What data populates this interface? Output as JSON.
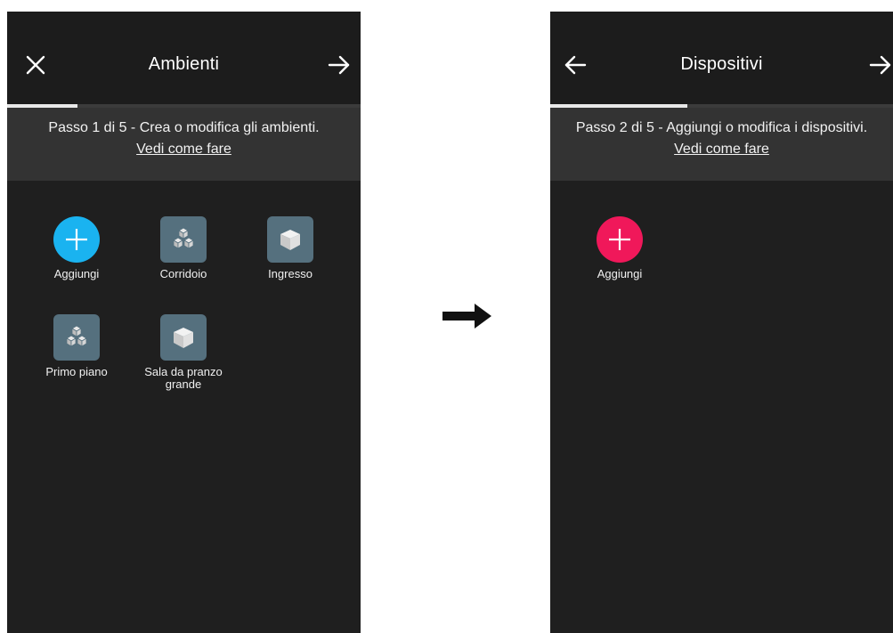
{
  "colors": {
    "add_ambienti": "#1ab3f0",
    "add_dispositivi": "#f0185a",
    "tile_bg": "#55707e"
  },
  "screen1": {
    "title": "Ambienti",
    "progress": 0.2,
    "step_text": "Passo 1 di 5 - Crea o modifica gli ambienti.",
    "help_link": "Vedi come fare",
    "tiles": [
      {
        "label": "Aggiungi",
        "icon": "plus-icon"
      },
      {
        "label": "Corridoio",
        "icon": "cubes-icon"
      },
      {
        "label": "Ingresso",
        "icon": "cube-icon"
      },
      {
        "label": "Primo piano",
        "icon": "cubes-icon"
      },
      {
        "label": "Sala da pranzo grande",
        "icon": "cube-icon"
      }
    ]
  },
  "screen2": {
    "title": "Dispositivi",
    "progress": 0.4,
    "step_text": "Passo 2 di 5 - Aggiungi o modifica i dispositivi.",
    "help_link": "Vedi come fare",
    "tiles": [
      {
        "label": "Aggiungi",
        "icon": "plus-icon"
      }
    ]
  }
}
